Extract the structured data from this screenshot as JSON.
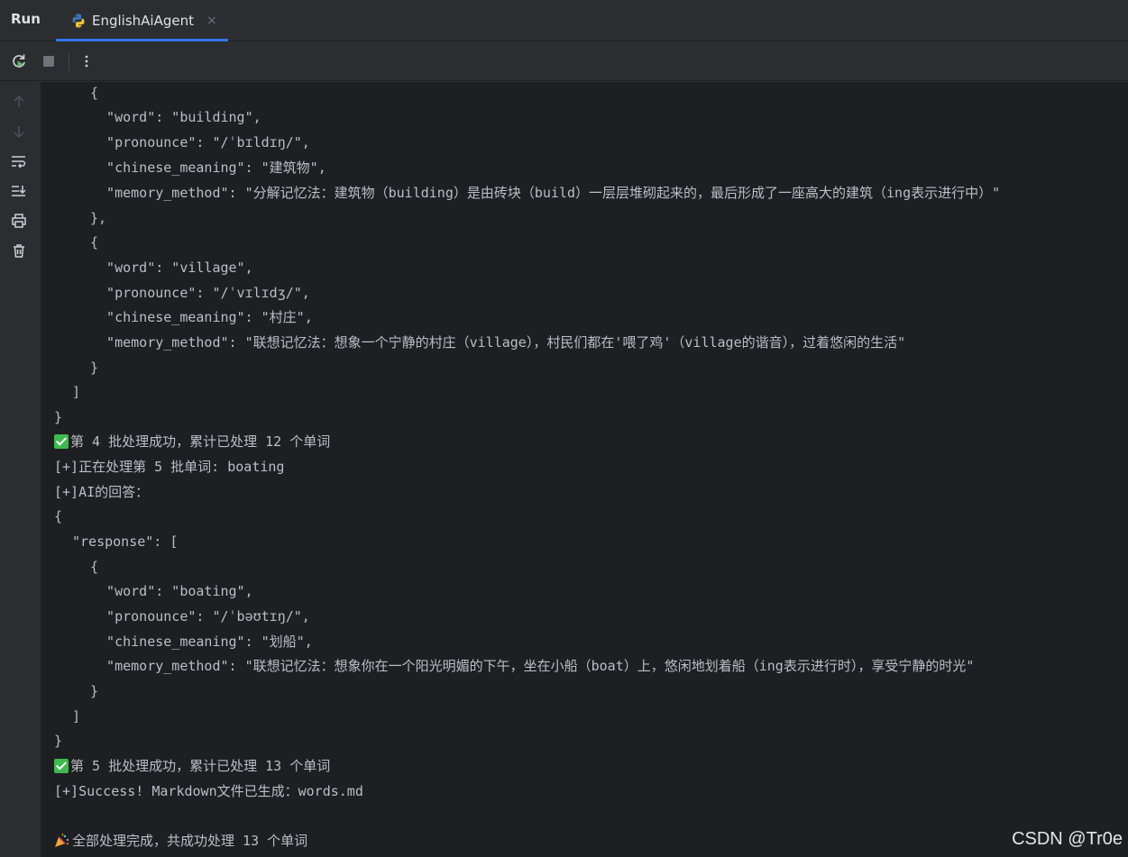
{
  "header": {
    "run_label": "Run",
    "tab": {
      "title": "EnglishAiAgent",
      "close_glyph": "×"
    }
  },
  "toolbar": {
    "buttons": [
      "rerun-icon",
      "stop-icon",
      "more-options-icon"
    ]
  },
  "sidebar": {
    "buttons": [
      "arrow-up-icon",
      "arrow-down-icon",
      "soft-wrap-icon",
      "scroll-to-end-icon",
      "print-icon",
      "trash-icon"
    ]
  },
  "console": {
    "lines": [
      "{",
      "  \"word\": \"building\",",
      "  \"pronounce\": \"/ˈbɪldɪŋ/\",",
      "  \"chinese_meaning\": \"建筑物\",",
      "  \"memory_method\": \"分解记忆法：建筑物（building）是由砖块（build）一层层堆砌起来的，最后形成了一座高大的建筑（ing表示进行中）\"",
      "},",
      "{",
      "  \"word\": \"village\",",
      "  \"pronounce\": \"/ˈvɪlɪdʒ/\",",
      "  \"chinese_meaning\": \"村庄\",",
      "  \"memory_method\": \"联想记忆法：想象一个宁静的村庄（village），村民们都在'喂了鸡'（village的谐音），过着悠闲的生活\"",
      "}",
      "]",
      "}",
      "第 4 批处理成功，累计已处理 12 个单词",
      "[+]正在处理第 5 批单词: boating",
      "[+]AI的回答：",
      "{",
      "\"response\": [",
      "{",
      "  \"word\": \"boating\",",
      "  \"pronounce\": \"/ˈbəʊtɪŋ/\",",
      "  \"chinese_meaning\": \"划船\",",
      "  \"memory_method\": \"联想记忆法：想象你在一个阳光明媚的下午，坐在小船（boat）上，悠闲地划着船（ing表示进行时），享受宁静的时光\"",
      "}",
      "]",
      "}",
      "第 5 批处理成功，累计已处理 13 个单词",
      "[+]Success! Markdown文件已生成：words.md",
      "全部处理完成，共成功处理 13 个单词"
    ]
  },
  "watermark": "CSDN @Tr0e",
  "colors": {
    "background": "#1e1f22",
    "panel": "#2b2d30",
    "text": "#bcbec4",
    "accent": "#3574f0",
    "success": "#3fb950"
  }
}
